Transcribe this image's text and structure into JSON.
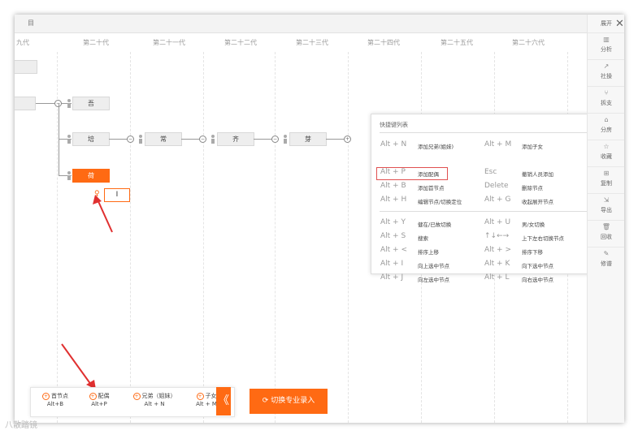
{
  "topbar": {
    "title": "目"
  },
  "generations": [
    "九代",
    "第二十代",
    "第二十一代",
    "第二十二代",
    "第二十三代",
    "第二十四代",
    "第二十五代",
    "第二十六代"
  ],
  "tree": {
    "left_node_partial": "",
    "nodes": [
      "吾",
      "培",
      "常",
      "齐",
      "芽"
    ],
    "selected_node": "荷",
    "spouse_input_value": "I"
  },
  "shortcut_panel": {
    "title": "快捷键列表",
    "rows1": [
      {
        "key": "Alt + N",
        "desc": "添加兄弟(姐妹)",
        "key2": "Alt + M",
        "desc2": "添加子女"
      },
      {
        "key": "Alt + P",
        "desc": "添加配偶",
        "key2": "Esc",
        "desc2": "撤销人员添加"
      },
      {
        "key": "Alt + B",
        "desc": "添加首节点",
        "key2": "Delete",
        "desc2": "删除节点"
      },
      {
        "key": "Alt + H",
        "desc": "编辑节点/切换定位",
        "key2": "Alt + G",
        "desc2": "收起展开节点"
      }
    ],
    "rows2": [
      {
        "key": "Alt + Y",
        "desc": "健在/已故切换",
        "key2": "Alt + U",
        "desc2": "男/女切换"
      },
      {
        "key": "Alt + S",
        "desc": "搜索",
        "key2": "↑↓←→",
        "desc2": "上下左右切换节点"
      },
      {
        "key": "Alt + <",
        "desc": "排序上移",
        "key2": "Alt + >",
        "desc2": "排序下移"
      },
      {
        "key": "Alt + I",
        "desc": "向上选中节点",
        "key2": "Alt + K",
        "desc2": "向下选中节点"
      },
      {
        "key": "Alt + J",
        "desc": "向左选中节点",
        "key2": "Alt + L",
        "desc2": "向右选中节点"
      }
    ]
  },
  "sidebar": {
    "header": "展开",
    "items": [
      {
        "icon": "▥",
        "label": "分析"
      },
      {
        "icon": "↗",
        "label": "社操"
      },
      {
        "icon": "⑂",
        "label": "拆支"
      },
      {
        "icon": "⌂",
        "label": "分房"
      },
      {
        "icon": "☆",
        "label": "收藏"
      },
      {
        "icon": "⊞",
        "label": "复制"
      },
      {
        "icon": "⇲",
        "label": "导出"
      },
      {
        "icon": "🗑",
        "label": "回收"
      },
      {
        "icon": "✎",
        "label": "修谱"
      }
    ]
  },
  "bottom_bar": {
    "items": [
      {
        "label": "首节点",
        "key": "Alt+B"
      },
      {
        "label": "配偶",
        "key": "Alt+P"
      },
      {
        "label": "兄弟（姐妹）",
        "key": "Alt + N"
      },
      {
        "label": "子女",
        "key": "Alt + M"
      }
    ],
    "collapse": "《",
    "switch_label": "切换专业录入"
  },
  "watermark": "八散踏镜",
  "colors": {
    "accent": "#ff6a13",
    "highlight": "#e05050"
  }
}
